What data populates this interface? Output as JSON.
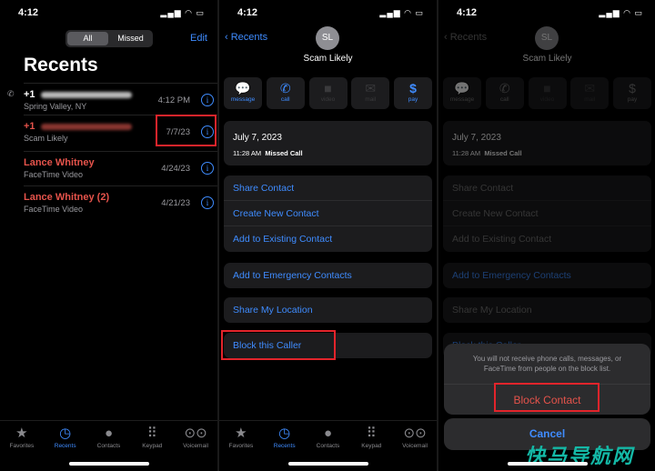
{
  "status": {
    "time": "4:12",
    "icons": "▂▄▆ ◠ ▭"
  },
  "recents": {
    "segments": [
      "All",
      "Missed"
    ],
    "edit": "Edit",
    "title": "Recents",
    "rows": [
      {
        "name": "+1",
        "sub": "Spring Valley, NY",
        "time": "4:12 PM",
        "missed": false
      },
      {
        "name": "+1",
        "sub": "Scam Likely",
        "time": "7/7/23",
        "missed": true
      },
      {
        "name": "Lance Whitney",
        "sub": "FaceTime Video",
        "time": "4/24/23",
        "missed": true
      },
      {
        "name": "Lance Whitney (2)",
        "sub": "FaceTime Video",
        "time": "4/21/23",
        "missed": true
      }
    ],
    "info": "i"
  },
  "tabs": [
    {
      "label": "Favorites",
      "icon": "★"
    },
    {
      "label": "Recents",
      "icon": "◷"
    },
    {
      "label": "Contacts",
      "icon": "●"
    },
    {
      "label": "Keypad",
      "icon": "⠿"
    },
    {
      "label": "Voicemail",
      "icon": "⊙⊙"
    }
  ],
  "detail": {
    "back": "Recents",
    "initials": "SL",
    "name": "Scam Likely",
    "actions": [
      {
        "label": "message",
        "icon": "💬",
        "enabled": true
      },
      {
        "label": "call",
        "icon": "✆",
        "enabled": true
      },
      {
        "label": "video",
        "icon": "■",
        "enabled": false
      },
      {
        "label": "mail",
        "icon": "✉",
        "enabled": false
      },
      {
        "label": "pay",
        "icon": "$",
        "enabled": true
      }
    ],
    "date": "July 7, 2023",
    "call_time": "11:28 AM",
    "call_type": "Missed Call",
    "share_contact": "Share Contact",
    "create_contact": "Create New Contact",
    "add_existing": "Add to Existing Contact",
    "emergency": "Add to Emergency Contacts",
    "share_location": "Share My Location",
    "block": "Block this Caller"
  },
  "sheet": {
    "message": "You will not receive phone calls, messages, or FaceTime from people on the block list.",
    "block": "Block Contact",
    "cancel": "Cancel"
  },
  "watermark": "快马导航网",
  "colors": {
    "accent": "#3f8cff",
    "missed": "#e5534b",
    "highlight": "#e3242b"
  }
}
